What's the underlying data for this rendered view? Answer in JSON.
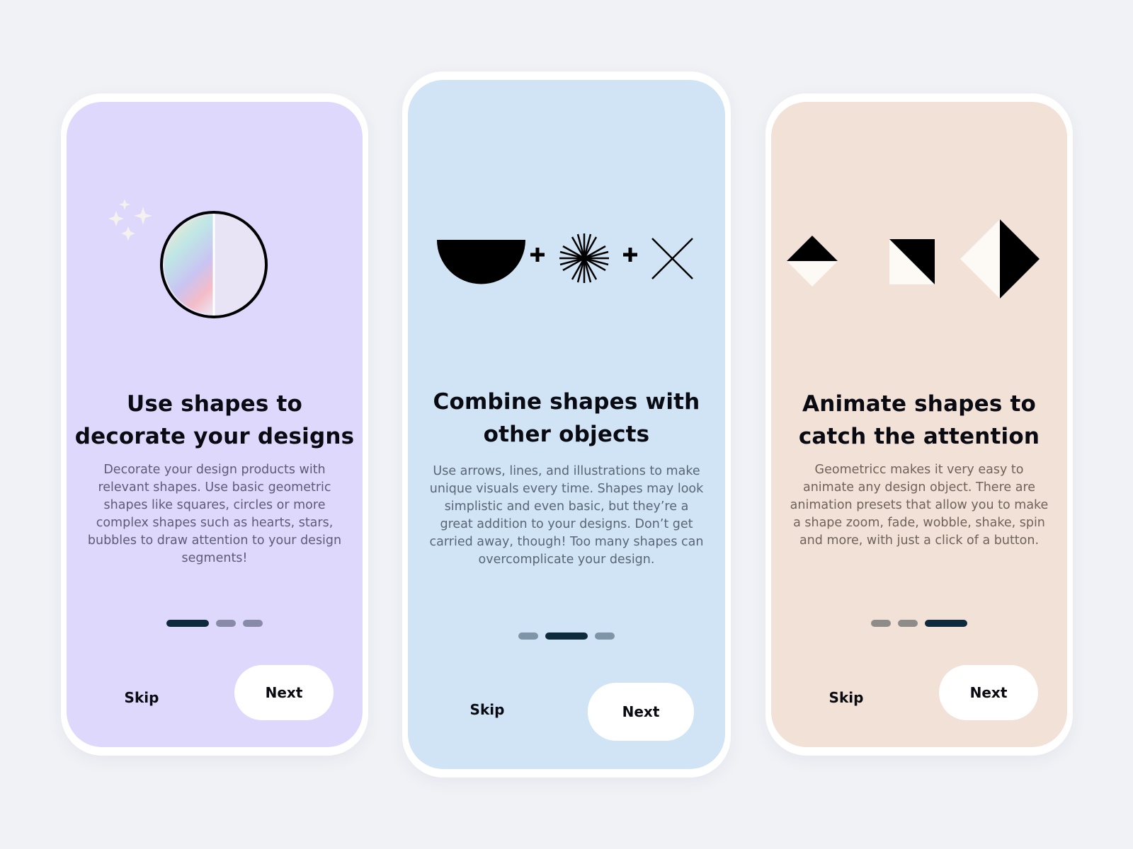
{
  "screens": [
    {
      "title": "Use shapes to decorate your designs",
      "body": "Decorate your design products with relevant shapes. Use basic geometric shapes like squares, circles or more complex shapes such as hearts, stars, bubbles to draw attention to your design segments!",
      "illustration": [
        "sparkles-icon",
        "iridescent-circle-icon"
      ],
      "pagination": {
        "current": 1,
        "total": 3
      },
      "skip_label": "Skip",
      "next_label": "Next",
      "background": "#ddd8fc"
    },
    {
      "title": "Combine shapes with other objects",
      "body": "Use arrows, lines, and illustrations to make unique visuals every time. Shapes may look simplistic and even basic, but they’re a great addition to your designs. Don’t get carried away, though! Too many shapes can overcomplicate your design.",
      "illustration": [
        "half-circle-icon",
        "plus-icon",
        "starburst-icon",
        "plus-icon",
        "cross-icon"
      ],
      "pagination": {
        "current": 2,
        "total": 3
      },
      "skip_label": "Skip",
      "next_label": "Next",
      "background": "#d0e4f5"
    },
    {
      "title": "Animate shapes to catch the attention",
      "body": "Geometricc makes it very easy to animate any design object. There are animation presets that allow you to make a shape zoom, fade, wobble, shake, spin and more, with just a click of a button.",
      "illustration": [
        "split-diamond-small-icon",
        "split-square-icon",
        "split-diamond-large-icon"
      ],
      "pagination": {
        "current": 3,
        "total": 3
      },
      "skip_label": "Skip",
      "next_label": "Next",
      "background": "#f1e1d6"
    }
  ],
  "colors": {
    "page_background": "#f1f2f6",
    "dot_active": "#0e2b3d",
    "text_dark": "#0a0a12"
  }
}
